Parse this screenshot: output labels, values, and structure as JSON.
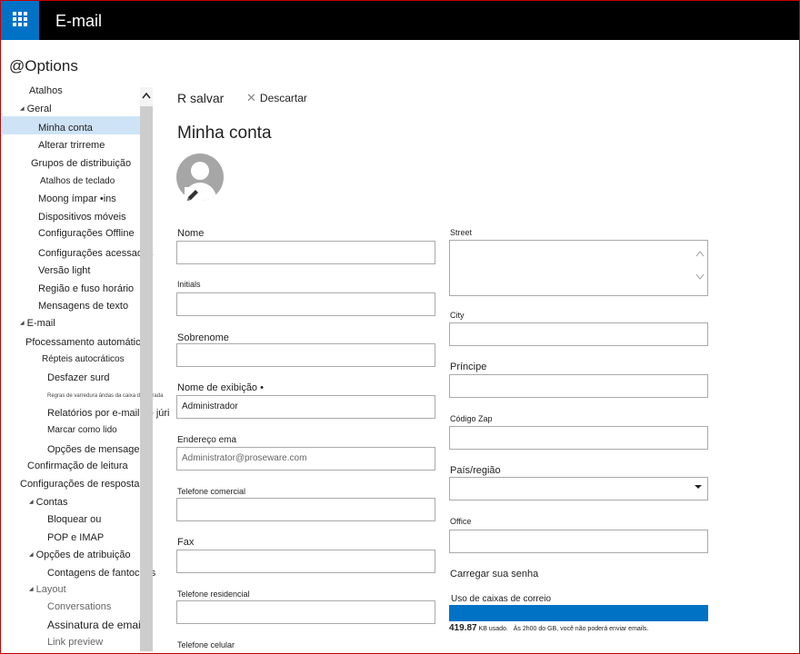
{
  "app": {
    "title": "E-mail"
  },
  "options": {
    "title": "@Options"
  },
  "nav": {
    "items": [
      {
        "label": "Atalhos"
      },
      {
        "label": "Geral"
      },
      {
        "label": "Minha conta"
      },
      {
        "label": "Alterar trirreme"
      },
      {
        "label": "Grupos de distribuição"
      },
      {
        "label": "Atalhos de teclado"
      },
      {
        "label": "Moong ímpar •ins"
      },
      {
        "label": "Dispositivos móveis"
      },
      {
        "label": "Configurações Offline"
      },
      {
        "label": "Configurações acessadas"
      },
      {
        "label": "Versão light"
      },
      {
        "label": "Região e fuso horário"
      },
      {
        "label": "Mensagens de texto"
      },
      {
        "label": "E-mail"
      },
      {
        "label": "Pfocessamento automático"
      },
      {
        "label": "Répteis autocráticos"
      },
      {
        "label": "Desfazer surd"
      },
      {
        "label": "Regras de varredura ândas da caixa de entrada"
      },
      {
        "label": "Relatórios por e-mail do júri"
      },
      {
        "label": "Marcar como lido"
      },
      {
        "label": "Opções de mensagem"
      },
      {
        "label": "Confirmação de leitura"
      },
      {
        "label": "Configurações de resposta"
      },
      {
        "label": "Contas"
      },
      {
        "label": "Bloquear ou"
      },
      {
        "label": "POP e IMAP"
      },
      {
        "label": "Opções de atribuição"
      },
      {
        "label": "Contagens de fantoches"
      },
      {
        "label": "Layout"
      },
      {
        "label": "Conversations"
      },
      {
        "label": "Assinatura de email"
      },
      {
        "label": "Link preview"
      }
    ]
  },
  "toolbar": {
    "save_label": "R salvar",
    "discard_label": "Descartar"
  },
  "page": {
    "heading": "Minha conta"
  },
  "form": {
    "left": [
      {
        "label": "Nome",
        "value": ""
      },
      {
        "label": "Initials",
        "value": ""
      },
      {
        "label": "Sobrenome",
        "value": ""
      },
      {
        "label": "Nome de exibição •",
        "value": "Administrador"
      },
      {
        "label": "Endereço ema",
        "value": "Administrator@proseware.com"
      },
      {
        "label": "Telefone comercial",
        "value": ""
      },
      {
        "label": "Fax",
        "value": ""
      },
      {
        "label": "Telefone residencial",
        "value": ""
      },
      {
        "label": "Telefone celular",
        "value": ""
      }
    ],
    "right": [
      {
        "label": "Street",
        "value": ""
      },
      {
        "label": "City",
        "value": ""
      },
      {
        "label": "Príncipe",
        "value": ""
      },
      {
        "label": "Código Zap",
        "value": ""
      },
      {
        "label": "País/região",
        "value": ""
      },
      {
        "label": "Office",
        "value": ""
      }
    ]
  },
  "password_link": "Carregar sua senha",
  "mailbox": {
    "label": "Uso de caixas de correio",
    "used": "419.87",
    "used_unit": "KB usado.",
    "warning": "Às 2h00 do GB, você não poderá enviar emails."
  },
  "colors": {
    "accent": "#0072c6",
    "topbar": "#000000",
    "selected": "#cfe3f6"
  }
}
